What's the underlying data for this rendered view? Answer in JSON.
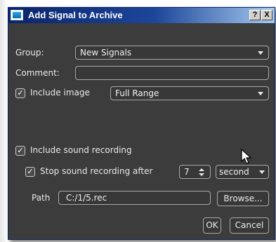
{
  "window": {
    "title": "Add Signal to Archive",
    "help_label": "?",
    "close_label": "X"
  },
  "form": {
    "group_label": "Group:",
    "group_value": "New Signals",
    "comment_label": "Comment:",
    "comment_value": "",
    "include_image_label": "Include image",
    "include_image_checked": true,
    "image_range_value": "Full Range",
    "include_sound_label": "Include sound recording",
    "include_sound_checked": true,
    "stop_sound_label": "Stop sound recording after",
    "stop_sound_checked": true,
    "stop_after_value": "7",
    "stop_unit_value": "second",
    "path_label": "Path",
    "path_value": "C:/1/5.rec",
    "browse_label": "Browse..."
  },
  "footer": {
    "ok_label": "OK",
    "cancel_label": "Cancel"
  },
  "check_glyph": "✓",
  "icons": [
    "app-icon",
    "dropdown-arrow-icon",
    "checkmark-icon",
    "spinner-up-icon",
    "spinner-down-icon",
    "mouse-pointer-icon"
  ],
  "colors": {
    "dialog_background": "#3c3c3c",
    "titlebar_start": "#0a246a",
    "titlebar_end": "#a6caf0",
    "text": "#e9e9e9",
    "field_border": "#a9a9a9"
  }
}
